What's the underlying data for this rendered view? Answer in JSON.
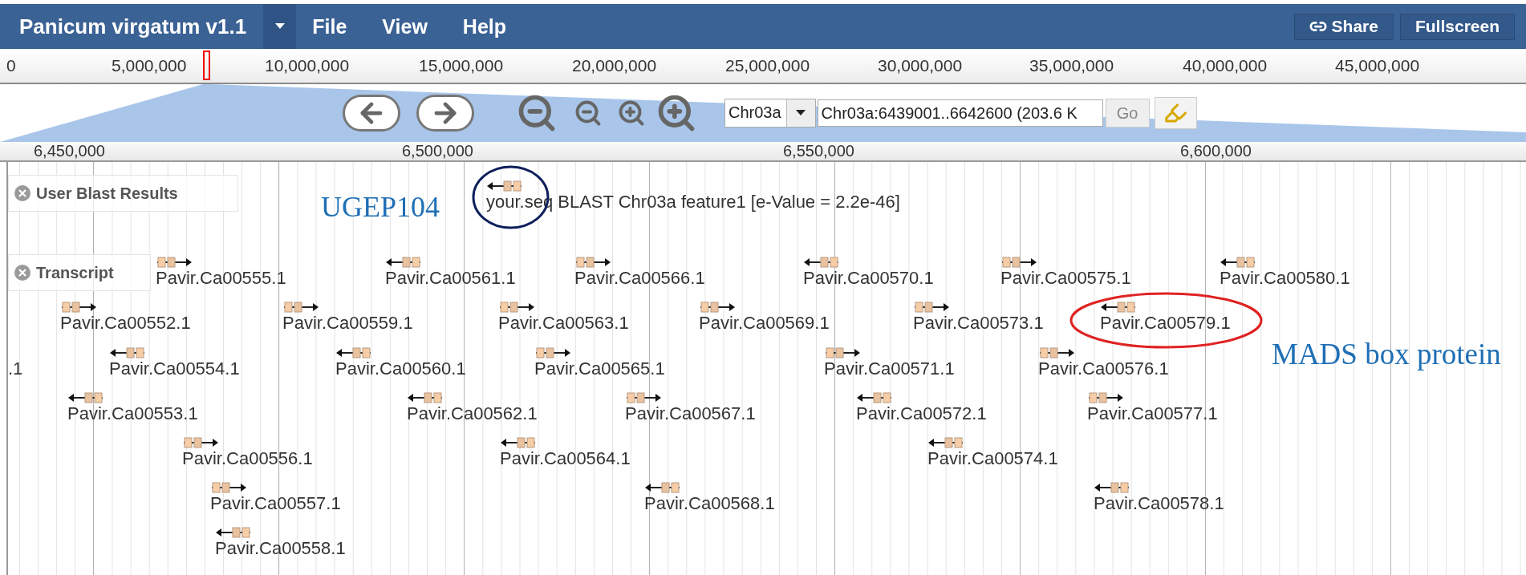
{
  "app": {
    "title": "Panicum virgatum v1.1",
    "menu": [
      "File",
      "View",
      "Help"
    ],
    "buttons": [
      {
        "label": "Share",
        "kind": "share"
      },
      {
        "label": "Fullscreen",
        "kind": "plain"
      }
    ]
  },
  "overview_ruler": {
    "ticks": [
      "0",
      "5,000,000",
      "10,000,000",
      "15,000,000",
      "20,000,000",
      "25,000,000",
      "30,000,000",
      "35,000,000",
      "40,000,000",
      "45,000,000"
    ]
  },
  "navigation": {
    "chromosome": "Chr03a",
    "location": "Chr03a:6439001..6642600 (203.6 K",
    "go": "Go"
  },
  "detail_ruler": {
    "ticks": [
      "6,450,000",
      "6,500,000",
      "6,550,000",
      "6,600,000"
    ]
  },
  "tracks": [
    {
      "label": "User Blast Results",
      "rows": [
        {
          "features": [
            {
              "label": "your.seq BLAST Chr03a feature1 [e-Value = 2.2e-46]",
              "reverse": true
            }
          ]
        }
      ]
    },
    {
      "label": "Transcript",
      "rows": [
        {
          "features": [
            {
              "label": "Pavir.Ca00555.1",
              "reverse": false
            },
            {
              "label": "Pavir.Ca00561.1",
              "reverse": true
            },
            {
              "label": "Pavir.Ca00566.1",
              "reverse": false
            },
            {
              "label": "Pavir.Ca00570.1",
              "reverse": true
            },
            {
              "label": "Pavir.Ca00575.1",
              "reverse": false
            },
            {
              "label": "Pavir.Ca00580.1",
              "reverse": true
            }
          ]
        },
        {
          "features": [
            {
              "label": "Pavir.Ca00552.1",
              "reverse": false
            },
            {
              "label": "Pavir.Ca00559.1",
              "reverse": false
            },
            {
              "label": "Pavir.Ca00563.1",
              "reverse": false
            },
            {
              "label": "Pavir.Ca00569.1",
              "reverse": false
            },
            {
              "label": "Pavir.Ca00573.1",
              "reverse": false
            },
            {
              "label": "Pavir.Ca00579.1",
              "reverse": true
            }
          ]
        },
        {
          "features": [
            {
              "label": ".1"
            },
            {
              "label": "Pavir.Ca00554.1",
              "reverse": true
            },
            {
              "label": "Pavir.Ca00560.1",
              "reverse": true
            },
            {
              "label": "Pavir.Ca00565.1",
              "reverse": false
            },
            {
              "label": "Pavir.Ca00571.1",
              "reverse": false
            },
            {
              "label": "Pavir.Ca00576.1",
              "reverse": false
            }
          ]
        },
        {
          "features": [
            {
              "label": "Pavir.Ca00553.1",
              "reverse": true
            },
            {
              "label": "Pavir.Ca00562.1",
              "reverse": true
            },
            {
              "label": "Pavir.Ca00567.1",
              "reverse": false
            },
            {
              "label": "Pavir.Ca00572.1",
              "reverse": true
            },
            {
              "label": "Pavir.Ca00577.1",
              "reverse": false
            }
          ]
        },
        {
          "features": [
            {
              "label": "Pavir.Ca00556.1",
              "reverse": false
            },
            {
              "label": "Pavir.Ca00564.1",
              "reverse": true
            },
            {
              "label": "Pavir.Ca00574.1",
              "reverse": true
            }
          ]
        },
        {
          "features": [
            {
              "label": "Pavir.Ca00557.1",
              "reverse": false
            },
            {
              "label": "Pavir.Ca00568.1",
              "reverse": true
            },
            {
              "label": "Pavir.Ca00578.1",
              "reverse": true
            }
          ]
        },
        {
          "features": [
            {
              "label": "Pavir.Ca00558.1",
              "reverse": true
            }
          ]
        }
      ]
    }
  ],
  "annotations": [
    {
      "kind": "label",
      "text": "UGEP104",
      "color": "#1f6fb5"
    },
    {
      "kind": "circle",
      "color": "#0e1f5b"
    },
    {
      "kind": "circle",
      "color": "#e02222"
    },
    {
      "kind": "label",
      "text": "MADS box protein",
      "color": "#1f6fb5"
    }
  ]
}
